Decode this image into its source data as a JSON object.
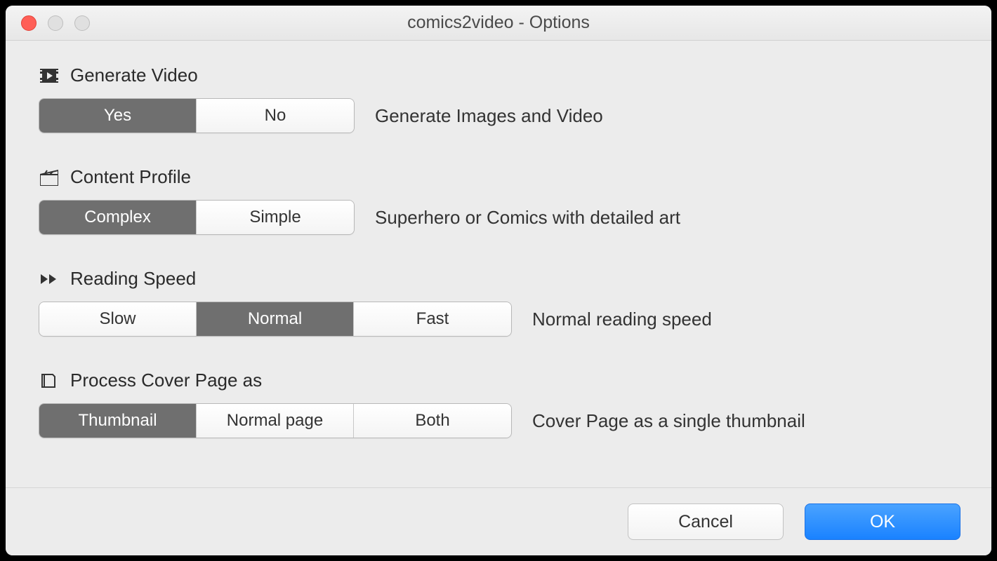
{
  "window": {
    "title": "comics2video - Options"
  },
  "sections": {
    "generate_video": {
      "title": "Generate Video",
      "options": {
        "yes": "Yes",
        "no": "No"
      },
      "selected": "yes",
      "description": "Generate Images and Video"
    },
    "content_profile": {
      "title": "Content Profile",
      "options": {
        "complex": "Complex",
        "simple": "Simple"
      },
      "selected": "complex",
      "description": "Superhero or Comics with detailed art"
    },
    "reading_speed": {
      "title": "Reading Speed",
      "options": {
        "slow": "Slow",
        "normal": "Normal",
        "fast": "Fast"
      },
      "selected": "normal",
      "description": "Normal reading speed"
    },
    "cover_page": {
      "title": "Process Cover Page as",
      "options": {
        "thumbnail": "Thumbnail",
        "normal_page": "Normal page",
        "both": "Both"
      },
      "selected": "thumbnail",
      "description": "Cover Page as a single thumbnail"
    }
  },
  "footer": {
    "cancel": "Cancel",
    "ok": "OK"
  }
}
